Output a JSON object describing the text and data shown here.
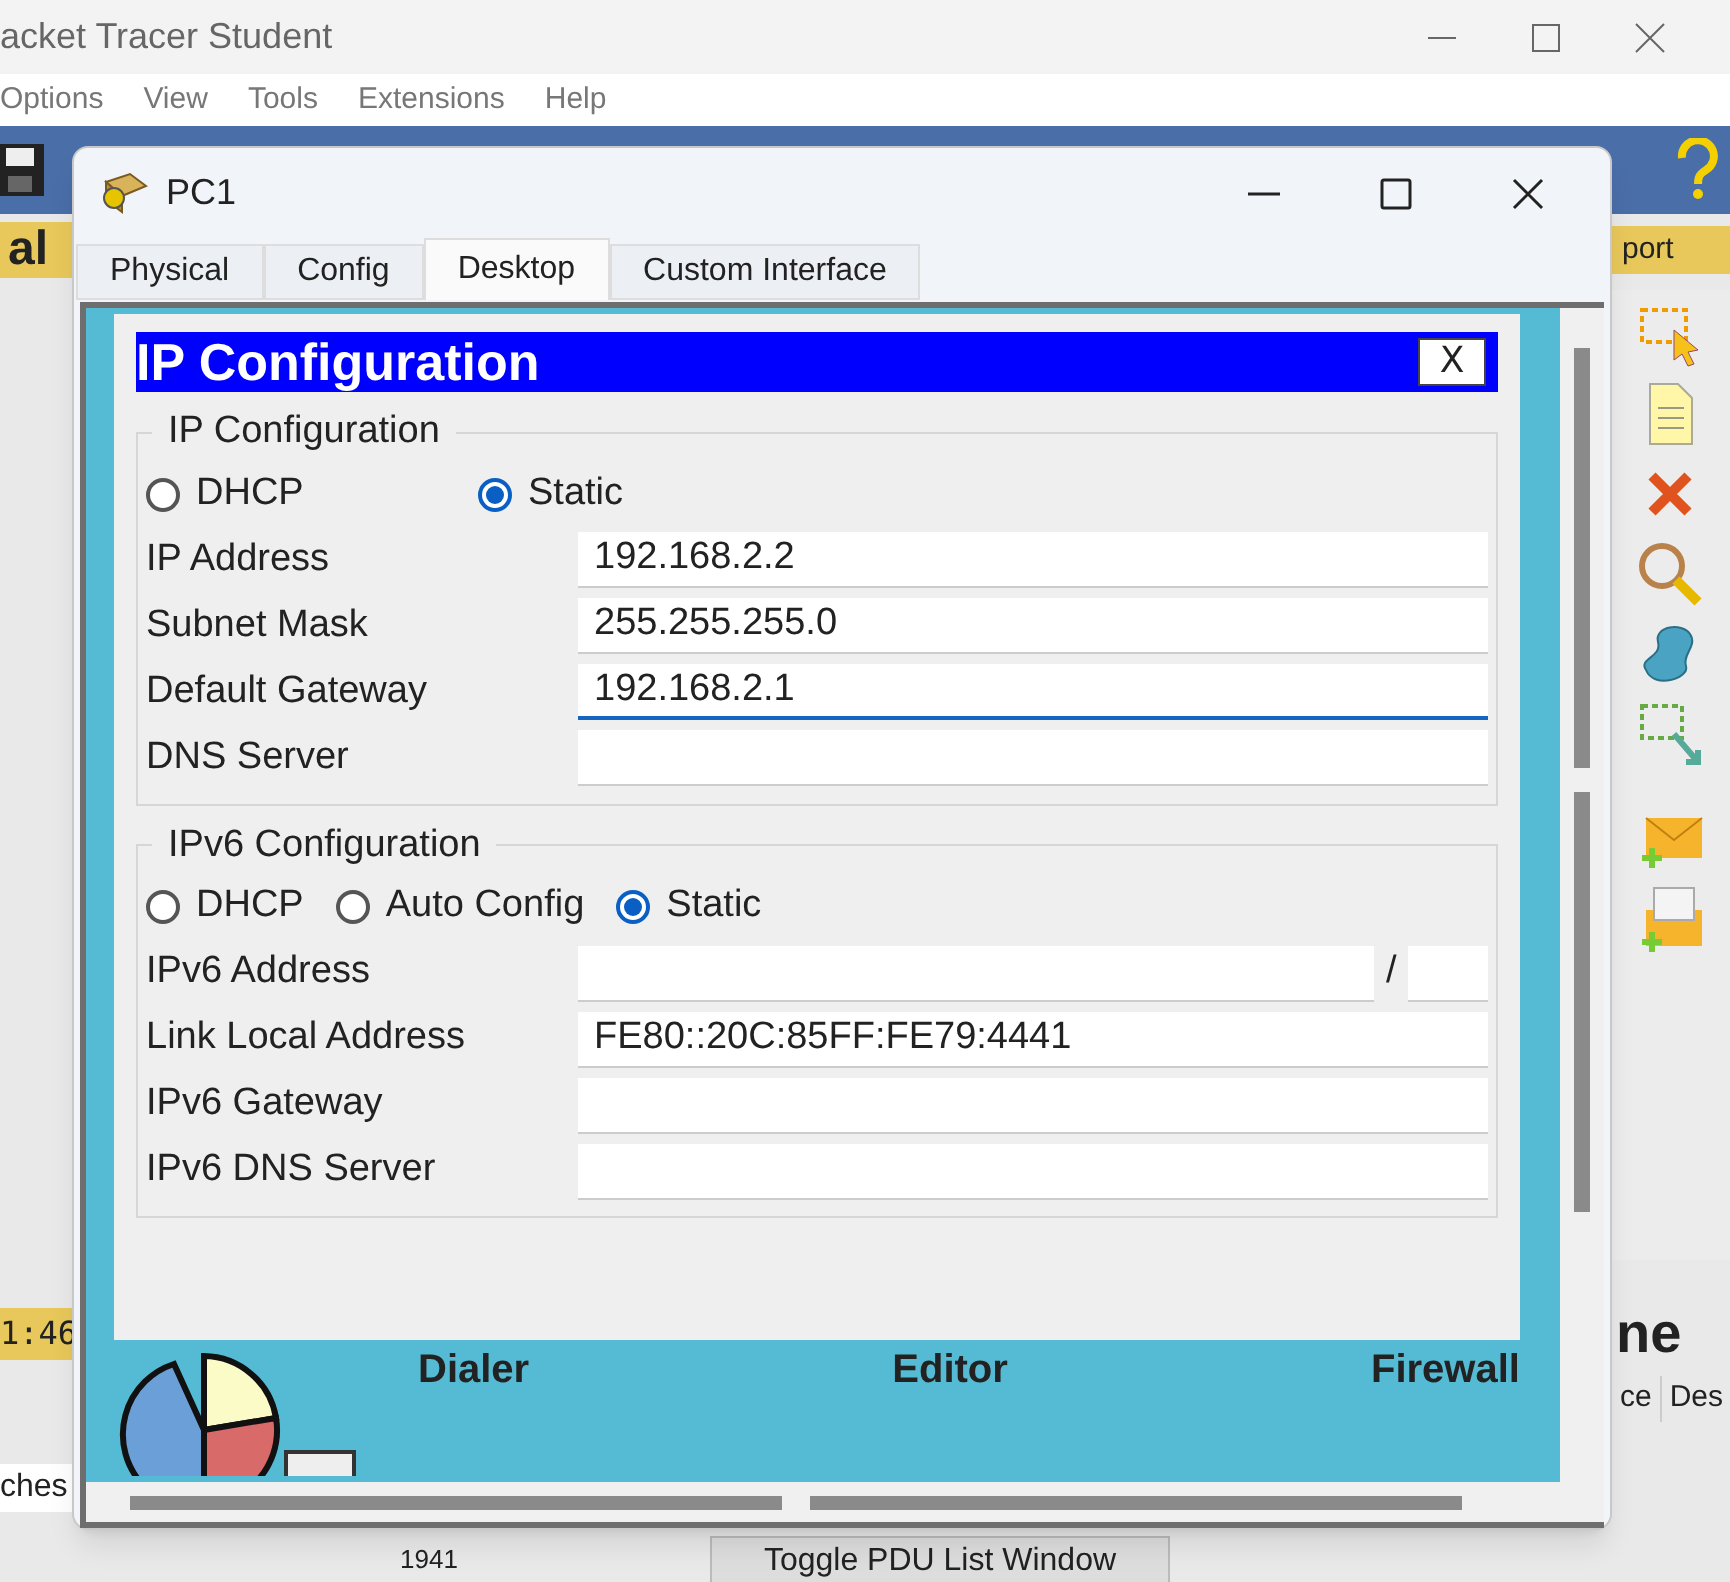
{
  "app": {
    "title": "acket Tracer Student",
    "menu": [
      "Options",
      "View",
      "Tools",
      "Extensions",
      "Help"
    ],
    "left_tab": "al",
    "right_tab": "port",
    "clock": "1:46",
    "device_group": "ches",
    "realtime_label": "ne",
    "pdu_columns": [
      "ce",
      "Des"
    ],
    "toggle_button": "Toggle PDU List Window",
    "device_model": "1941"
  },
  "window": {
    "title": "PC1",
    "tabs": [
      {
        "label": "Physical",
        "selected": false
      },
      {
        "label": "Config",
        "selected": false
      },
      {
        "label": "Desktop",
        "selected": true
      },
      {
        "label": "Custom Interface",
        "selected": false
      }
    ]
  },
  "desktop": {
    "apps": [
      "Dialer",
      "Editor",
      "Firewall"
    ]
  },
  "ip_config": {
    "title": "IP Configuration",
    "close": "X",
    "ipv4": {
      "legend": "IP Configuration",
      "modes": [
        {
          "label": "DHCP",
          "selected": false
        },
        {
          "label": "Static",
          "selected": true
        }
      ],
      "fields": [
        {
          "label": "IP Address",
          "value": "192.168.2.2",
          "focused": false
        },
        {
          "label": "Subnet Mask",
          "value": "255.255.255.0",
          "focused": false
        },
        {
          "label": "Default Gateway",
          "value": "192.168.2.1",
          "focused": true
        },
        {
          "label": "DNS Server",
          "focused": false
        }
      ]
    },
    "ipv6": {
      "legend": "IPv6 Configuration",
      "modes": [
        {
          "label": "DHCP",
          "selected": false
        },
        {
          "label": "Auto Config",
          "selected": false
        },
        {
          "label": "Static",
          "selected": true
        }
      ],
      "address_label": "IPv6 Address",
      "separator": "/",
      "fields": [
        {
          "label": "Link Local Address",
          "value": "FE80::20C:85FF:FE79:4441",
          "focused": false
        },
        {
          "label": "IPv6 Gateway",
          "focused": false
        },
        {
          "label": "IPv6 DNS Server",
          "focused": false
        }
      ]
    }
  }
}
